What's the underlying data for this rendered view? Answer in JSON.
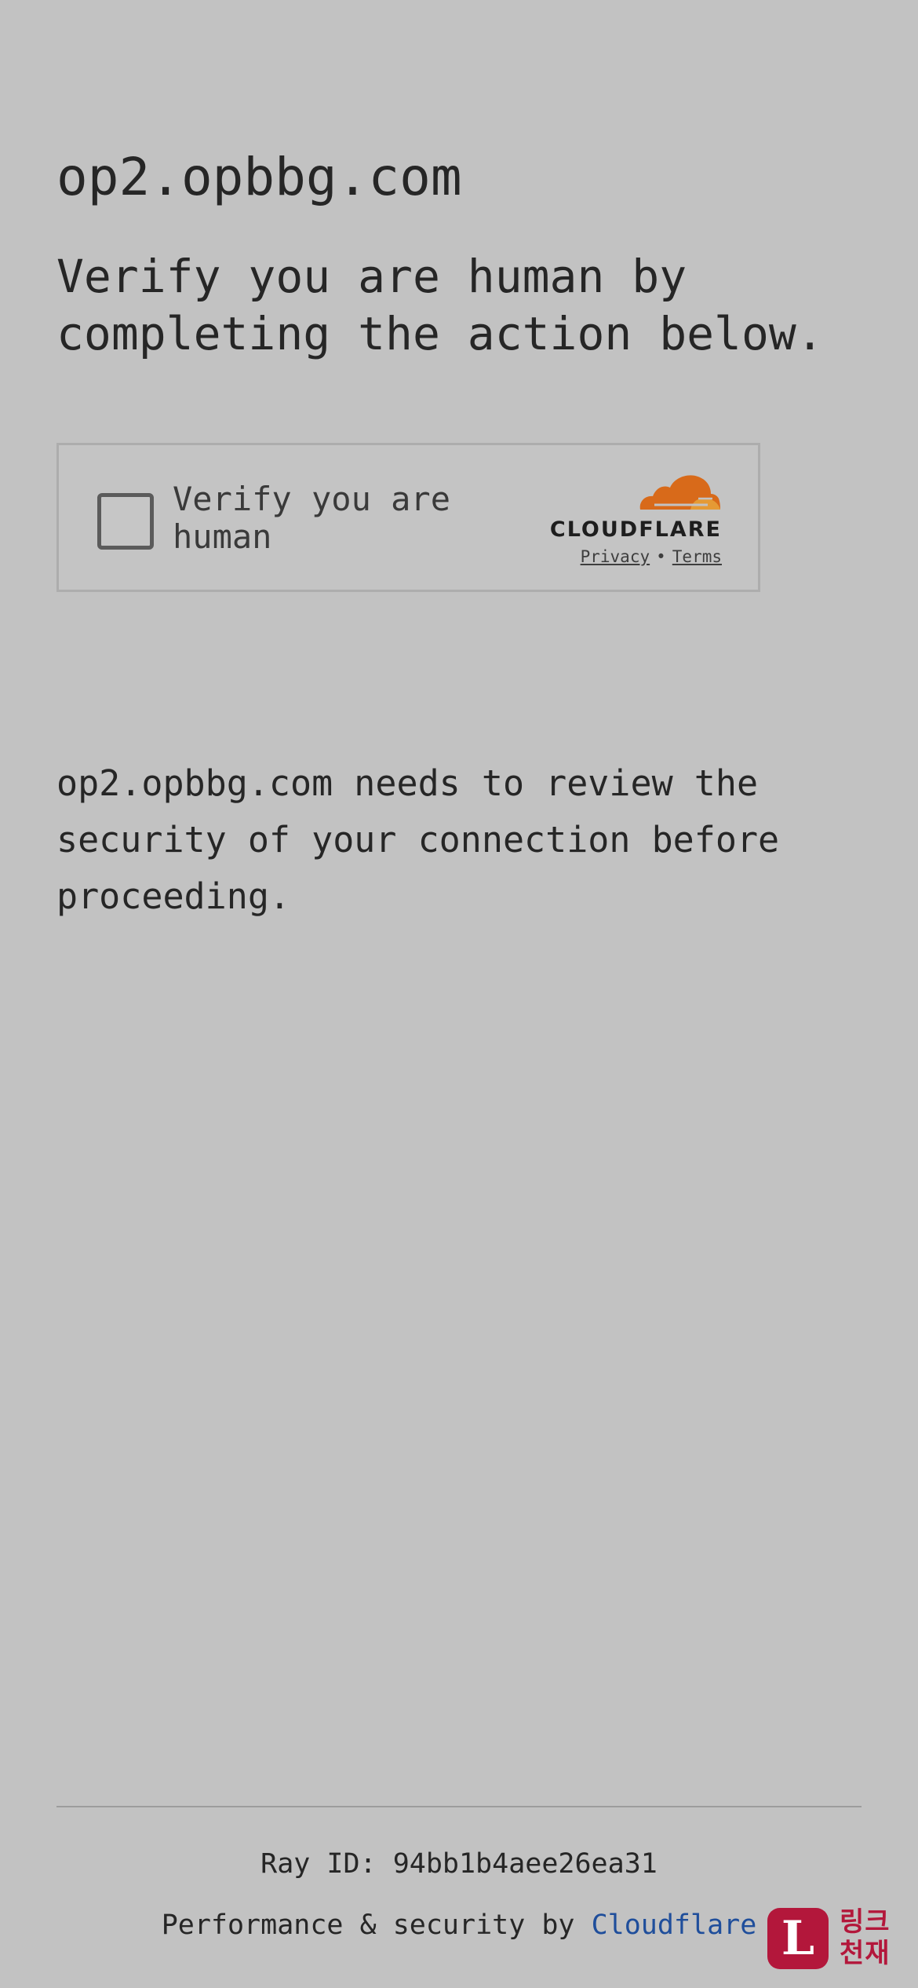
{
  "page": {
    "site_title": "op2.opbbg.com",
    "headline": "Verify you are human by completing the action below.",
    "description": "op2.opbbg.com needs to review the security of your connection before proceeding."
  },
  "challenge_widget": {
    "checkbox_label": "Verify you are human",
    "checkbox_checked": false,
    "brand_name": "CLOUDFLARE",
    "privacy_link": "Privacy",
    "links_separator": "•",
    "terms_link": "Terms",
    "brand_icon": "cloud-icon",
    "brand_color_primary": "#d86a1a",
    "brand_color_secondary": "#e59a35"
  },
  "footer": {
    "ray_id": "Ray ID: 94bb1b4aee26ea31",
    "performance_prefix": "Performance & security by",
    "performance_link": "Cloudflare",
    "link_color": "#1f4e9b"
  },
  "watermark_badge": {
    "letter": "L",
    "text": "링크천재",
    "color": "#b3173b"
  }
}
